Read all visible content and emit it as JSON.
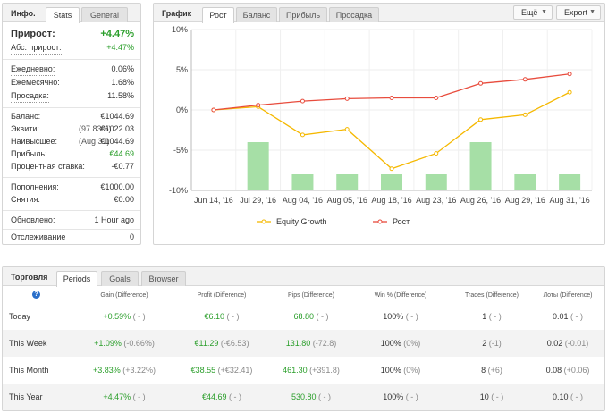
{
  "info": {
    "title": "Инфо.",
    "tabs": [
      "Stats",
      "General"
    ],
    "rows": [
      {
        "label": "Прирост:",
        "value": "+4.47%"
      },
      {
        "label": "Абс. прирост:",
        "value": "+4.47%"
      },
      {
        "label": "Ежедневно:",
        "value": "0.06%"
      },
      {
        "label": "Ежемесячно:",
        "value": "1.68%"
      },
      {
        "label": "Просадка:",
        "value": "11.58%"
      },
      {
        "label": "Баланс:",
        "mid": "",
        "value": "€1044.69"
      },
      {
        "label": "Эквити:",
        "mid": "(97.83%)",
        "value": "€1022.03"
      },
      {
        "label": "Наивысшее:",
        "mid": "(Aug 31)",
        "value": "€1044.69"
      },
      {
        "label": "Прибыль:",
        "mid": "",
        "value": "€44.69"
      },
      {
        "label": "Процентная ставка:",
        "mid": "",
        "value": "-€0.77"
      },
      {
        "label": "Пополнения:",
        "value": "€1000.00"
      },
      {
        "label": "Снятия:",
        "value": "€0.00"
      },
      {
        "label": "Обновлено:",
        "value": "1 Hour ago"
      },
      {
        "label": "Отслеживание",
        "value": "0"
      }
    ]
  },
  "chart_panel": {
    "title": "График",
    "tabs": [
      "Рост",
      "Баланс",
      "Прибыль",
      "Просадка"
    ],
    "more_button": "Ещё",
    "export_button": "Export",
    "legend": [
      "Equity Growth",
      "Рост"
    ]
  },
  "chart_data": {
    "type": "line",
    "categories": [
      "Jun 14, '16",
      "Jul 29, '16",
      "Aug 04, '16",
      "Aug 05, '16",
      "Aug 18, '16",
      "Aug 23, '16",
      "Aug 26, '16",
      "Aug 29, '16",
      "Aug 31, '16"
    ],
    "ylim": [
      -10,
      10
    ],
    "yticks": [
      "10%",
      "5%",
      "0%",
      "-5%",
      "-10%"
    ],
    "series": [
      {
        "name": "Equity Growth",
        "color": "#f5b800",
        "values": [
          0.0,
          0.4,
          -3.1,
          -2.4,
          -7.3,
          -5.4,
          -1.2,
          -0.6,
          2.2
        ]
      },
      {
        "name": "Рост",
        "color": "#e84c3d",
        "values": [
          0.0,
          0.6,
          1.1,
          1.4,
          1.5,
          1.5,
          3.3,
          3.8,
          4.47
        ]
      }
    ],
    "bars": {
      "color": "#a6dfa6",
      "values": [
        0,
        6,
        2,
        2,
        2,
        2,
        6,
        2,
        2
      ]
    },
    "grid": true,
    "legend_position": "bottom"
  },
  "trading": {
    "title": "Торговля",
    "tabs": [
      "Periods",
      "Goals",
      "Browser"
    ],
    "help_icon": "?",
    "headers": [
      "Gain (Difference)",
      "Profit (Difference)",
      "Pips (Difference)",
      "Win % (Difference)",
      "Trades (Difference)",
      "Лоты (Difference)"
    ],
    "rows": [
      {
        "period": "Today",
        "gain": "+0.59%",
        "gain_d": "( - )",
        "profit": "€6.10",
        "profit_d": "( - )",
        "pips": "68.80",
        "pips_d": "( - )",
        "win": "100%",
        "win_d": "( - )",
        "trades": "1",
        "trades_d": "( - )",
        "lots": "0.01",
        "lots_d": "( - )"
      },
      {
        "period": "This Week",
        "gain": "+1.09%",
        "gain_d": "(-0.66%)",
        "profit": "€11.29",
        "profit_d": "(-€6.53)",
        "pips": "131.80",
        "pips_d": "(-72.8)",
        "win": "100%",
        "win_d": "(0%)",
        "trades": "2",
        "trades_d": "(-1)",
        "lots": "0.02",
        "lots_d": "(-0.01)"
      },
      {
        "period": "This Month",
        "gain": "+3.83%",
        "gain_d": "(+3.22%)",
        "profit": "€38.55",
        "profit_d": "(+€32.41)",
        "pips": "461.30",
        "pips_d": "(+391.8)",
        "win": "100%",
        "win_d": "(0%)",
        "trades": "8",
        "trades_d": "(+6)",
        "lots": "0.08",
        "lots_d": "(+0.06)"
      },
      {
        "period": "This Year",
        "gain": "+4.47%",
        "gain_d": "( - )",
        "profit": "€44.69",
        "profit_d": "( - )",
        "pips": "530.80",
        "pips_d": "( - )",
        "win": "100%",
        "win_d": "( - )",
        "trades": "10",
        "trades_d": "( - )",
        "lots": "0.10",
        "lots_d": "( - )"
      }
    ]
  }
}
